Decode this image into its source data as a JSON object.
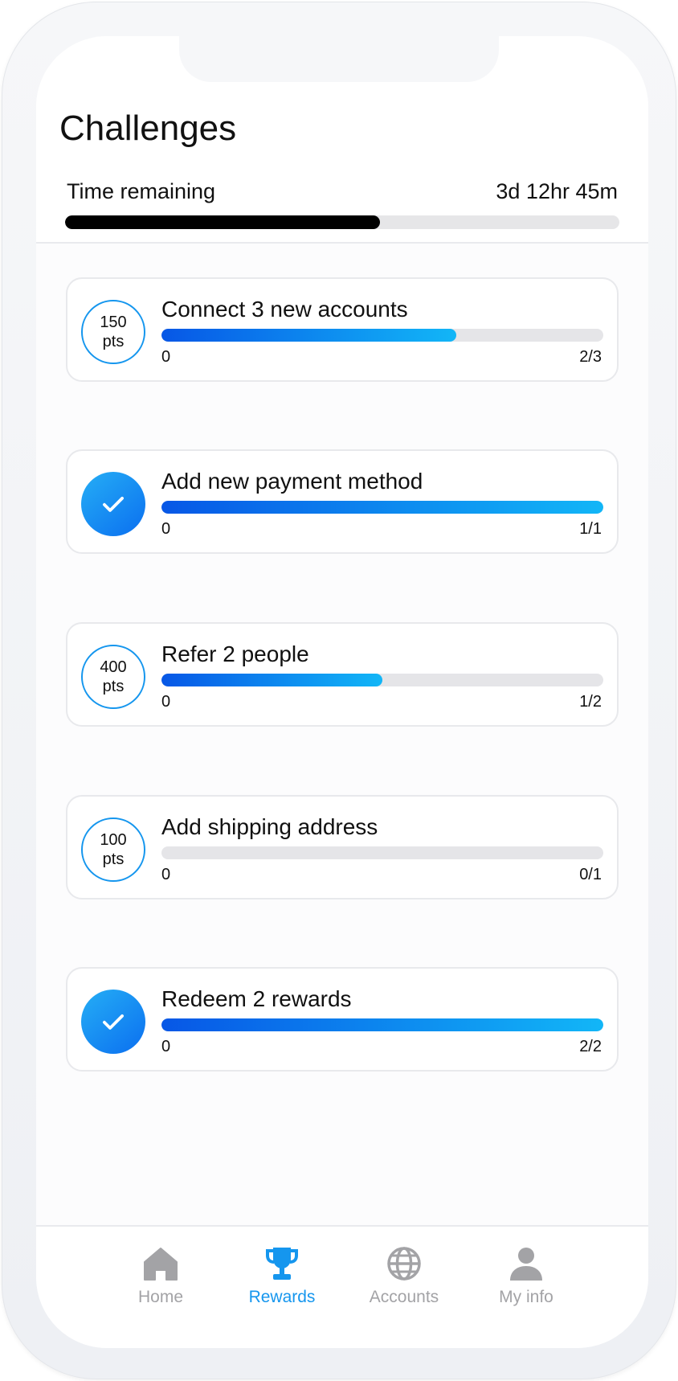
{
  "page": {
    "title": "Challenges"
  },
  "timer": {
    "label": "Time remaining",
    "value": "3d 12hr 45m",
    "progress": 0.568
  },
  "challenges": [
    {
      "title": "Connect 3 new accounts",
      "badge_value": "150",
      "badge_unit": "pts",
      "completed": false,
      "min": "0",
      "max": "2/3",
      "progress": 0.667
    },
    {
      "title": "Add new payment method",
      "completed": true,
      "badge_icon": "check-icon",
      "min": "0",
      "max": "1/1",
      "progress": 1.0
    },
    {
      "title": "Refer 2 people",
      "badge_value": "400",
      "badge_unit": "pts",
      "completed": false,
      "min": "0",
      "max": "1/2",
      "progress": 0.5
    },
    {
      "title": "Add shipping address",
      "badge_value": "100",
      "badge_unit": "pts",
      "completed": false,
      "min": "0",
      "max": "0/1",
      "progress": 0.0
    },
    {
      "title": "Redeem 2 rewards",
      "completed": true,
      "badge_icon": "check-icon",
      "min": "0",
      "max": "2/2",
      "progress": 1.0
    }
  ],
  "tabs": [
    {
      "label": "Home",
      "icon": "home-icon",
      "active": false
    },
    {
      "label": "Rewards",
      "icon": "trophy-icon",
      "active": true
    },
    {
      "label": "Accounts",
      "icon": "globe-icon",
      "active": false
    },
    {
      "label": "My info",
      "icon": "person-icon",
      "active": false
    }
  ],
  "colors": {
    "accent": "#1596ee",
    "progress_start": "#0757e6",
    "progress_end": "#12b6f7",
    "inactive_tab": "#a3a3a6"
  }
}
